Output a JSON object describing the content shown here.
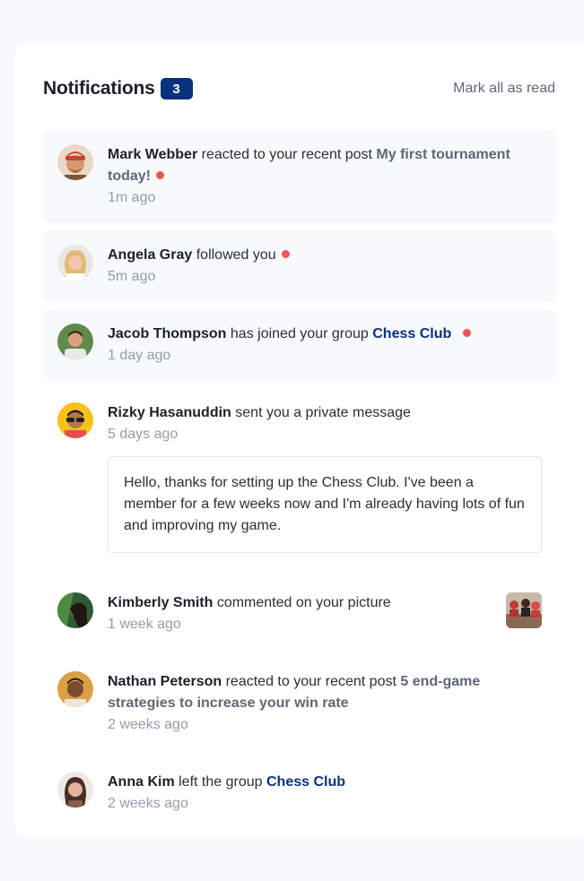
{
  "header": {
    "title": "Notifications",
    "count": "3",
    "mark_all": "Mark all as read"
  },
  "notifications": [
    {
      "name": "Mark Webber",
      "action": "reacted to your recent post",
      "post": "My first tournament today!",
      "time": "1m ago",
      "unread": true,
      "avatar_icon": "avatar-mark-webber"
    },
    {
      "name": "Angela Gray",
      "action": "followed you",
      "time": "5m ago",
      "unread": true,
      "avatar_icon": "avatar-angela-gray"
    },
    {
      "name": "Jacob Thompson",
      "action": "has joined your group",
      "group": "Chess Club",
      "time": "1 day ago",
      "unread": true,
      "avatar_icon": "avatar-jacob-thompson"
    },
    {
      "name": "Rizky Hasanuddin",
      "action": "sent you a private message",
      "time": "5 days ago",
      "unread": false,
      "message": "Hello, thanks for setting up the Chess Club. I've been a member for a few weeks now and I'm already having lots of fun and improving my game.",
      "avatar_icon": "avatar-rizky-hasanuddin"
    },
    {
      "name": "Kimberly Smith",
      "action": "commented on your picture",
      "time": "1 week ago",
      "unread": false,
      "avatar_icon": "avatar-kimberly-smith",
      "thumbnail_icon": "chess-picture-thumbnail"
    },
    {
      "name": "Nathan Peterson",
      "action": "reacted to your recent post",
      "post": "5 end-game strategies to increase your win rate",
      "time": "2 weeks ago",
      "unread": false,
      "avatar_icon": "avatar-nathan-peterson"
    },
    {
      "name": "Anna Kim",
      "action": "left the group",
      "group": "Chess Club",
      "time": "2 weeks ago",
      "unread": false,
      "avatar_icon": "avatar-anna-kim"
    }
  ],
  "colors": {
    "page_bg": "#f7f9fc",
    "card_bg": "#ffffff",
    "unread_bg": "#f7fafd",
    "badge_bg": "#0a317b",
    "group_link": "#0a317b",
    "post_link": "#5e6778",
    "unread_dot": "#f65552",
    "time_text": "#939cad"
  }
}
